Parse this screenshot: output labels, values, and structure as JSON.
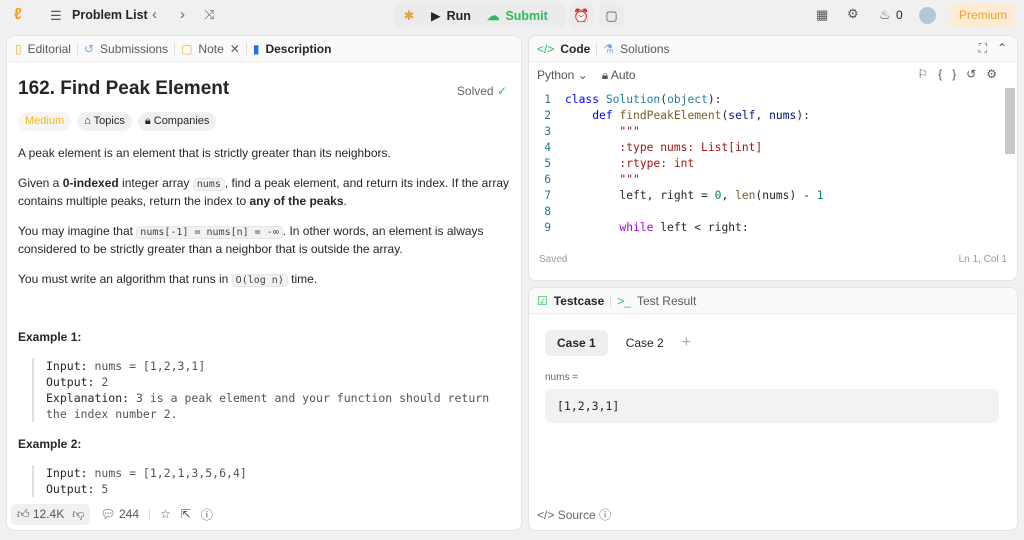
{
  "topbar": {
    "problem_list": "Problem List",
    "run": "Run",
    "submit": "Submit",
    "streak": "0",
    "premium": "Premium"
  },
  "left": {
    "tabs": [
      "Editorial",
      "Submissions",
      "Note",
      "Description"
    ],
    "title": "162. Find Peak Element",
    "solved": "Solved",
    "difficulty": "Medium",
    "topics": "Topics",
    "companies": "Companies",
    "p1": "A peak element is an element that is strictly greater than its neighbors.",
    "p2a": "Given a ",
    "p2b": "0-indexed",
    "p2c": " integer array ",
    "p2code": "nums",
    "p2d": ", find a peak element, and return its index. If the array contains multiple peaks, return the index to ",
    "p2e": "any of the peaks",
    "p2f": ".",
    "p3a": "You may imagine that ",
    "p3code": "nums[-1] = nums[n] = -∞",
    "p3b": ". In other words, an element is always considered to be strictly greater than a neighbor that is outside the array.",
    "p4a": "You must write an algorithm that runs in ",
    "p4code": "O(log n)",
    "p4b": " time.",
    "ex1": {
      "title": "Example 1:",
      "input_label": "Input:",
      "input": " nums = [1,2,3,1]",
      "output_label": "Output:",
      "output": " 2",
      "expl_label": "Explanation:",
      "expl": " 3 is a peak element and your function should return the index number 2."
    },
    "ex2": {
      "title": "Example 2:",
      "input_label": "Input:",
      "input": " nums = [1,2,1,3,5,6,4]",
      "output_label": "Output:",
      "output": " 5"
    },
    "likes": "12.4K",
    "comments": "244"
  },
  "code": {
    "tabs": [
      "Code",
      "Solutions"
    ],
    "language": "Python",
    "auto": "Auto",
    "saved": "Saved",
    "cursor": "Ln 1, Col 1"
  },
  "testcase": {
    "tabs": [
      "Testcase",
      "Test Result"
    ],
    "cases": [
      "Case 1",
      "Case 2"
    ],
    "label": "nums =",
    "value": "[1,2,3,1]",
    "source": "Source"
  }
}
